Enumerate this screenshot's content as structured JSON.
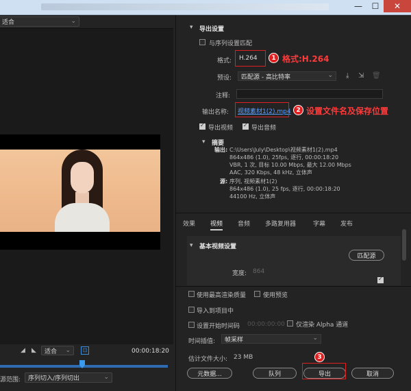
{
  "left": {
    "fit_value": "适合",
    "fit2_value": "适合",
    "timecode": "00:00:18:20",
    "range_label": "源范围:",
    "range_value": "序列切入/序列切出"
  },
  "export": {
    "section_title": "导出设置",
    "match_sequence_label": "与序列设置匹配",
    "format_label": "格式:",
    "format_value": "H.264",
    "preset_label": "预设:",
    "preset_value": "匹配源 - 高比特率",
    "comment_label": "注释:",
    "output_name_label": "输出名称:",
    "output_name_value": "视频素材1(2).mp4",
    "export_video_label": "导出视频",
    "export_audio_label": "导出音频",
    "summary_title": "摘要",
    "output_label": "输出:",
    "output_lines": [
      "C:\\Users\\July\\Desktop\\视频素材1(2).mp4",
      "864x486 (1.0), 25fps, 逐行, 00:00:18:20",
      "VBR, 1 次, 目标 10.00 Mbps, 最大 12.00 Mbps",
      "AAC, 320 Kbps, 48 kHz, 立体声"
    ],
    "source_label": "源:",
    "source_lines": [
      "序列, 视频素材1(2)",
      "864x486 (1.0), 25 fps, 逐行, 00:00:18:20",
      "44100 Hz, 立体声"
    ]
  },
  "tabs": [
    "效果",
    "视频",
    "音频",
    "多路复用器",
    "字幕",
    "发布"
  ],
  "video_settings": {
    "section_title": "基本视频设置",
    "match_source_button": "匹配源",
    "width_label": "宽度:",
    "width_value": "864"
  },
  "options": {
    "max_render_quality": "使用最高渲染质量",
    "use_previews": "使用预览",
    "import_into_project": "导入到项目中",
    "set_start_timecode": "设置开始时间码",
    "start_timecode_value": "00:00:00:00",
    "render_alpha_only": "仅渲染 Alpha 通道",
    "time_interpolation_label": "时间插值:",
    "time_interpolation_value": "帧采样",
    "estimated_size_label": "估计文件大小:",
    "estimated_size_value": "23 MB"
  },
  "buttons": {
    "metadata": "元数据...",
    "queue": "队列",
    "export": "导出",
    "cancel": "取消"
  },
  "annotations": {
    "one": "1",
    "two": "2",
    "three": "3",
    "format_note": "格式:H.264",
    "name_note": "设置文件名及保存位置"
  },
  "colors": {
    "annotation_red": "#e02020",
    "link_blue": "#5aa0ff",
    "panel_bg": "#232323"
  }
}
